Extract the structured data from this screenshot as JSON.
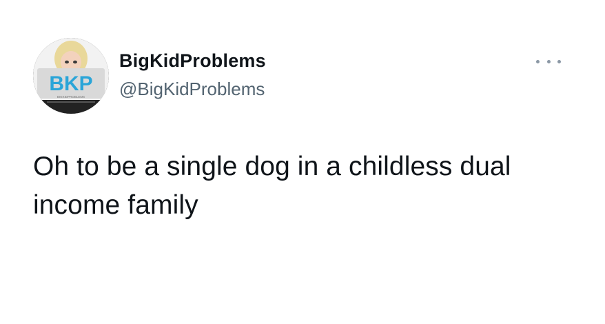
{
  "author": {
    "display_name": "BigKidProblems",
    "handle": "@BigKidProblems",
    "avatar_text": "BKP",
    "avatar_subtext": "BIGKIDPROBLEMS"
  },
  "menu": {
    "icon": "more-horizontal-icon"
  },
  "tweet": {
    "text": "Oh to be a single dog in a childless dual income family"
  },
  "colors": {
    "text_primary": "#0f1419",
    "text_secondary": "#536471",
    "avatar_logo": "#2aa5d8"
  }
}
